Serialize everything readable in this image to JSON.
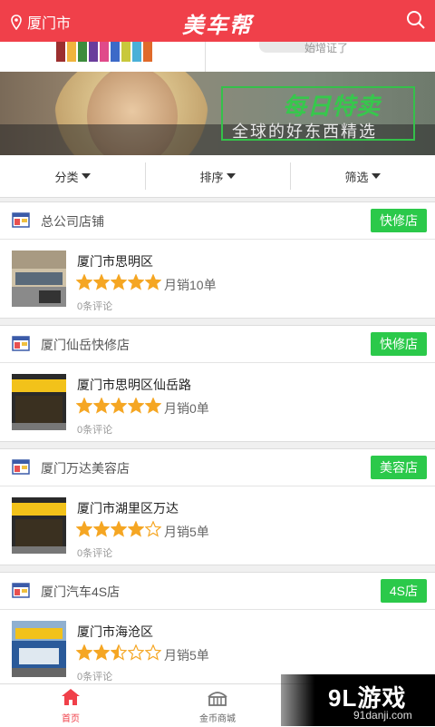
{
  "header": {
    "location": "厦门市",
    "logo": "美车帮"
  },
  "top_cards": {
    "right_caption": "始增证了"
  },
  "banner": {
    "title": "每日特卖",
    "subtitle": "全球的好东西精选"
  },
  "filters": [
    {
      "label": "分类"
    },
    {
      "label": "排序"
    },
    {
      "label": "筛选"
    }
  ],
  "stores": [
    {
      "name": "总公司店铺",
      "type": "快修店",
      "address": "厦门市思明区",
      "rating": 5,
      "sales": "月销10单",
      "reviews": "0条评论"
    },
    {
      "name": "厦门仙岳快修店",
      "type": "快修店",
      "address": "厦门市思明区仙岳路",
      "rating": 5,
      "sales": "月销0单",
      "reviews": "0条评论"
    },
    {
      "name": "厦门万达美容店",
      "type": "美容店",
      "address": "厦门市湖里区万达",
      "rating": 4,
      "sales": "月销5单",
      "reviews": "0条评论"
    },
    {
      "name": "厦门汽车4S店",
      "type": "4S店",
      "address": "厦门市海沧区",
      "rating": 2.5,
      "sales": "月销5单",
      "reviews": "0条评论"
    }
  ],
  "tabbar": {
    "home": "首页",
    "mall": "金币商城"
  },
  "watermark": {
    "brand": "9L游戏",
    "domain": "91danji.com"
  },
  "colors": {
    "header": "#f0404a",
    "badge": "#2bc94a",
    "star": "#f5a623",
    "promo": "#36c84c"
  },
  "icons": {
    "location": "location-pin-icon",
    "search": "search-icon",
    "home": "home-icon",
    "mall": "gold-mall-icon",
    "shop": "shop-icon",
    "caret": "caret-down-icon"
  }
}
